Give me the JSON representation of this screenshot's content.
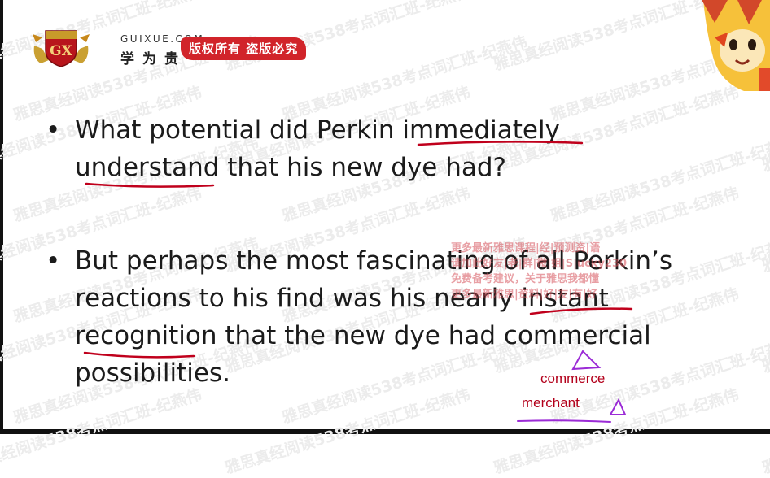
{
  "brand": {
    "url": "GUIXUE.COM",
    "name_cn": "学为贵",
    "copyright_badge": "版权所有 盗版必究",
    "shield_letters": "GX"
  },
  "watermark_text": "雅思真经阅读538考点词汇班-纪燕伟",
  "slide": {
    "question_1_lines": [
      "What potential did Perkin immediately",
      "understand that his new dye had?"
    ],
    "question_2_lines": [
      "But perhaps the most fascinating of all Perkin’s",
      "reactions to his find was his nearly instant",
      "recognition that the new dye had commercial",
      "possibilities."
    ]
  },
  "promo_overlay_lines": [
    "更多最新雅思课程|经|预测资|语",
    "请加此好友|老|群|微|姐|S|ucky230",
    "免费备考建议，关于雅思我都懂",
    "更多最新雅思|资料|好|友|有|好"
  ],
  "handwritten_notes": {
    "note_1": "commerce",
    "note_2": "merchant"
  },
  "colors": {
    "ink_red": "#c0001c",
    "ink_purple": "#9b2bd6",
    "badge_red": "#d1242a",
    "watermark": "#ececec"
  }
}
